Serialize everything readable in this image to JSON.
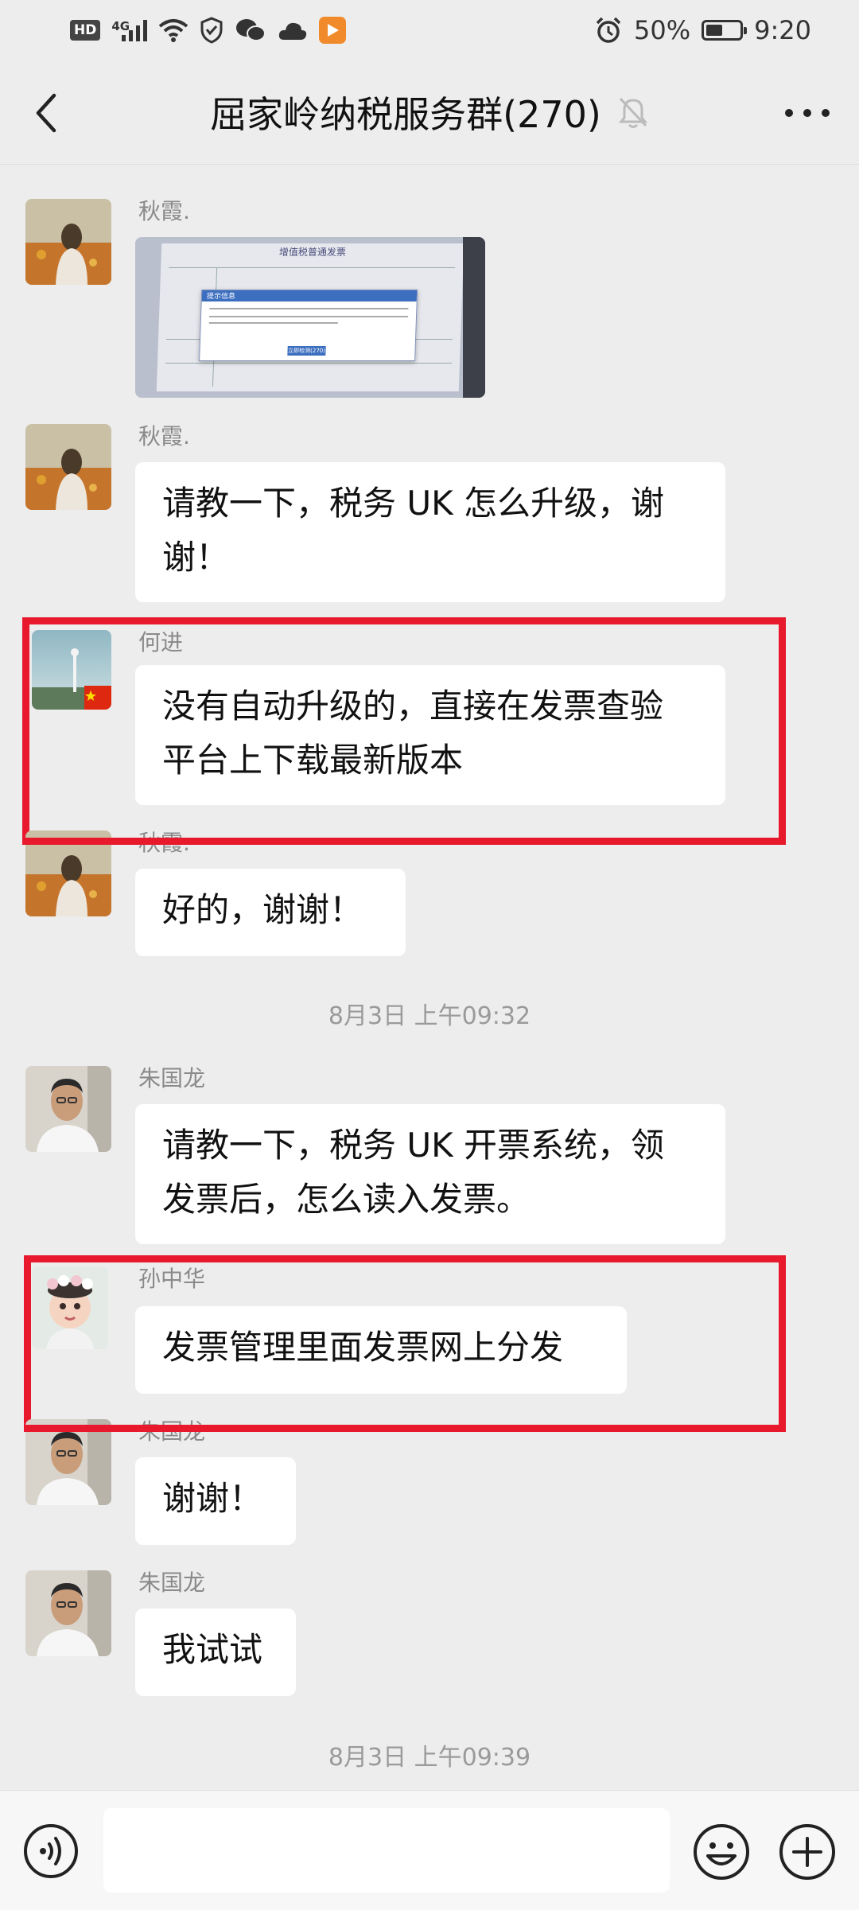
{
  "status_bar": {
    "hd": "HD",
    "network": "4G",
    "battery_text": "50%",
    "battery_level": 0.5,
    "time": "9:20"
  },
  "header": {
    "title": "屈家岭纳税服务群(270)",
    "back_icon": "chevron-left-icon",
    "mute_icon": "bell-off-icon",
    "more_icon": "more-dots-icon"
  },
  "messages": [
    {
      "sender": "秋霞.",
      "type": "image",
      "image_title": "增值税普通发票",
      "dialog_title": "提示信息",
      "dialog_button": "立即检测(270)"
    },
    {
      "sender": "秋霞.",
      "type": "text",
      "lines": [
        "请教一下，税务 UK 怎么升级，谢",
        "谢！"
      ]
    },
    {
      "sender": "何进",
      "type": "text",
      "lines": [
        "没有自动升级的，直接在发票查验",
        "平台上下载最新版本"
      ]
    },
    {
      "sender": "秋霞.",
      "type": "text",
      "lines": [
        "好的，谢谢！"
      ]
    },
    {
      "sender": "朱国龙",
      "type": "text",
      "lines": [
        "请教一下，税务 UK 开票系统，领",
        "发票后，怎么读入发票。"
      ]
    },
    {
      "sender": "孙中华",
      "type": "text",
      "lines": [
        "发票管理里面发票网上分发"
      ]
    },
    {
      "sender": "朱国龙",
      "type": "text",
      "lines": [
        "谢谢！"
      ]
    },
    {
      "sender": "朱国龙",
      "type": "text",
      "lines": [
        "我试试"
      ]
    }
  ],
  "timestamps": [
    "8月3日 上午09:32",
    "8月3日 上午09:39"
  ],
  "input_bar": {
    "voice_icon": "voice-icon",
    "emoji_icon": "emoji-icon",
    "plus_icon": "plus-circle-icon"
  },
  "colors": {
    "background": "#ededed",
    "highlight_box": "#e8192c",
    "bubble": "#ffffff"
  }
}
